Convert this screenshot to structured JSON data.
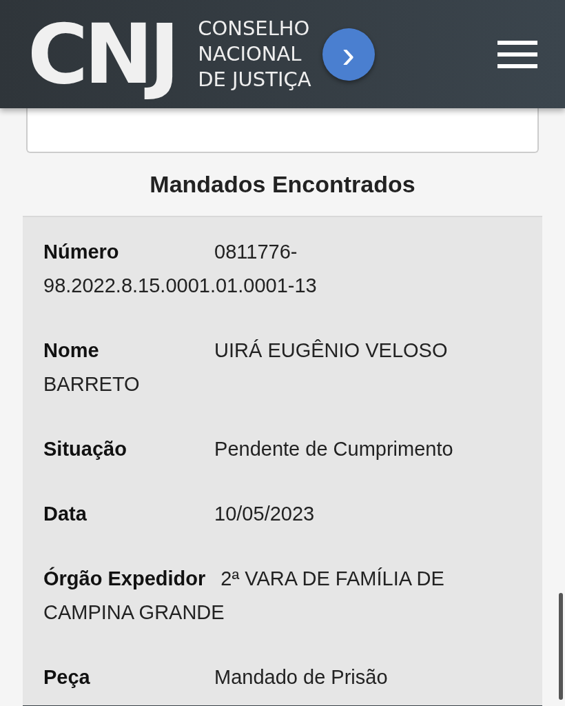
{
  "header": {
    "logo": "CNJ",
    "logo_text": [
      "CONSELHO",
      "NACIONAL",
      "DE JUSTIÇA"
    ],
    "arrow": "›"
  },
  "section_title": "Mandados Encontrados",
  "fields": [
    {
      "label": "Número",
      "value": "0811776-98.2022.8.15.0001.01.0001-13"
    },
    {
      "label": "Nome",
      "value": "UIRÁ EUGÊNIO VELOSO BARRETO"
    },
    {
      "label": "Situação",
      "value": "Pendente de Cumprimento"
    },
    {
      "label": "Data",
      "value": "10/05/2023"
    },
    {
      "label": "Órgão Expedidor",
      "value": "2ª VARA DE FAMÍLIA DE CAMPINA GRANDE"
    },
    {
      "label": "Peça",
      "value": "Mandado de Prisão"
    }
  ]
}
